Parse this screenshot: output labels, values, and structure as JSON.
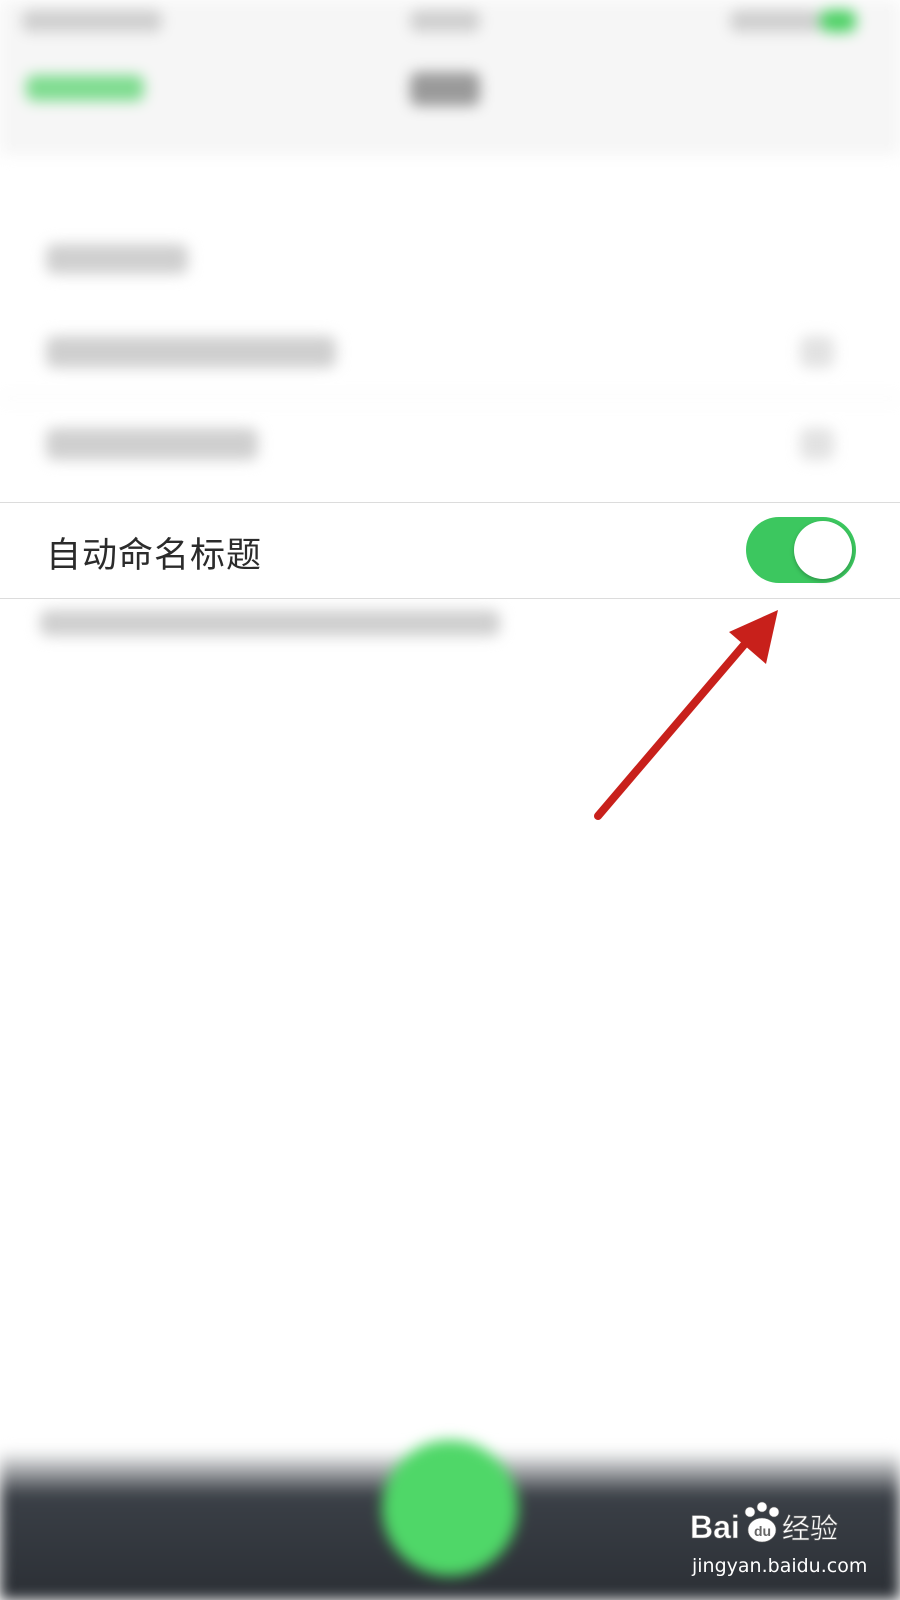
{
  "settings": {
    "auto_title_label": "自动命名标题",
    "auto_title_enabled": true
  },
  "watermark": {
    "url": "jingyan.baidu.com"
  },
  "colors": {
    "toggle_on": "#3cc75f",
    "arrow": "#c8201b",
    "accent_green": "#4cd164"
  }
}
